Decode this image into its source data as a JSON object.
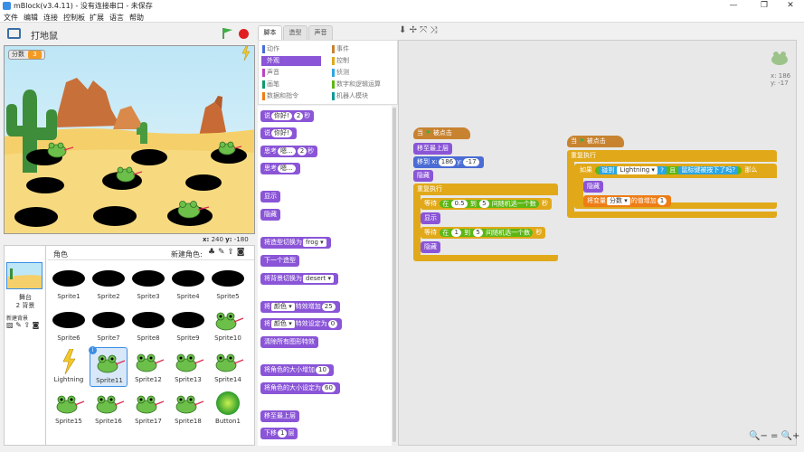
{
  "window": {
    "title": "mBlock(v3.4.11) - 没有连接串口 - 未保存",
    "controls": [
      "—",
      "❐",
      "✕"
    ]
  },
  "menu": [
    "文件",
    "编辑",
    "连接",
    "控制板",
    "扩展",
    "语言",
    "帮助"
  ],
  "stage": {
    "project_name": "打地鼠",
    "score_label": "分数",
    "score_value": "3",
    "mouse_x_label": "x:",
    "mouse_x": "240",
    "mouse_y_label": "y:",
    "mouse_y": "-180"
  },
  "sprites_panel": {
    "header": "角色",
    "new_sprite_label": "新建角色:",
    "stage_label": "舞台",
    "backdrops_count": "2 背景",
    "new_backdrop_label": "新建背景",
    "sprites": [
      {
        "name": "Sprite1",
        "kind": "hole"
      },
      {
        "name": "Sprite2",
        "kind": "hole"
      },
      {
        "name": "Sprite3",
        "kind": "hole"
      },
      {
        "name": "Sprite4",
        "kind": "hole"
      },
      {
        "name": "Sprite5",
        "kind": "hole"
      },
      {
        "name": "Sprite6",
        "kind": "hole"
      },
      {
        "name": "Sprite7",
        "kind": "hole"
      },
      {
        "name": "Sprite8",
        "kind": "hole"
      },
      {
        "name": "Sprite9",
        "kind": "hole"
      },
      {
        "name": "Sprite10",
        "kind": "frog"
      },
      {
        "name": "Lightning",
        "kind": "lightning"
      },
      {
        "name": "Sprite11",
        "kind": "frog",
        "selected": true,
        "badge": "i"
      },
      {
        "name": "Sprite12",
        "kind": "frog"
      },
      {
        "name": "Sprite13",
        "kind": "frog"
      },
      {
        "name": "Sprite14",
        "kind": "frog"
      },
      {
        "name": "Sprite15",
        "kind": "frog"
      },
      {
        "name": "Sprite16",
        "kind": "frog"
      },
      {
        "name": "Sprite17",
        "kind": "frog"
      },
      {
        "name": "Sprite18",
        "kind": "frog"
      },
      {
        "name": "Button1",
        "kind": "button"
      }
    ]
  },
  "tabs": [
    "脚本",
    "造型",
    "声音"
  ],
  "categories": [
    {
      "label": "动作",
      "color": "#4a6cd4"
    },
    {
      "label": "事件",
      "color": "#c88330"
    },
    {
      "label": "外观",
      "color": "#8a55d7",
      "active": true
    },
    {
      "label": "控制",
      "color": "#e1a91a"
    },
    {
      "label": "声音",
      "color": "#bb42c3"
    },
    {
      "label": "侦测",
      "color": "#2ca5e2"
    },
    {
      "label": "画笔",
      "color": "#0e9a6c"
    },
    {
      "label": "数字和逻辑运算",
      "color": "#5cb712"
    },
    {
      "label": "数据和指令",
      "color": "#ee7d16"
    },
    {
      "label": "机器人模块",
      "color": "#0e9a9a"
    }
  ],
  "palette": {
    "say_timed": {
      "pre": "说",
      "text": "你好!",
      "secs": "2",
      "post": "秒"
    },
    "say": {
      "pre": "说",
      "text": "你好!"
    },
    "think_timed": {
      "pre": "思考",
      "text": "嗯...",
      "secs": "2",
      "post": "秒"
    },
    "think": {
      "pre": "思考",
      "text": "嗯..."
    },
    "show": "显示",
    "hide": "隐藏",
    "switch_costume": {
      "pre": "将造型切换为",
      "value": "frog"
    },
    "next_costume": "下一个造型",
    "switch_backdrop": {
      "pre": "将背景切换为",
      "value": "desert"
    },
    "change_effect": {
      "pre": "将",
      "effect": "颜色",
      "mid": "特效增加",
      "value": "25"
    },
    "set_effect": {
      "pre": "将",
      "effect": "颜色",
      "mid": "特效设定为",
      "value": "0"
    },
    "clear_effects": "清除所有图形特效",
    "change_size": {
      "pre": "将角色的大小增加",
      "value": "10"
    },
    "set_size": {
      "pre": "将角色的大小设定为",
      "value": "60"
    },
    "go_front": "移至最上层",
    "go_back": {
      "pre": "下移",
      "value": "1",
      "post": "层"
    }
  },
  "scripts": {
    "s1": {
      "hat_pre": "当",
      "hat_post": "被点击",
      "front": "移至最上层",
      "goto_pre": "移到 x:",
      "goto_x": "186",
      "goto_mid": "y:",
      "goto_y": "-17",
      "hide": "隐藏",
      "forever": "重复执行",
      "wait1_pre": "等待",
      "wait1_mid": "在",
      "wait1_a": "0.5",
      "wait1_to": "到",
      "wait1_b": "5",
      "wait1_rand": "间随机选一个数",
      "wait1_post": "秒",
      "show": "显示",
      "wait2_pre": "等待",
      "wait2_mid": "在",
      "wait2_a": "1",
      "wait2_to": "到",
      "wait2_b": "5",
      "wait2_rand": "间随机选一个数",
      "wait2_post": "秒",
      "hide2": "隐藏"
    },
    "s2": {
      "hat_pre": "当",
      "hat_post": "被点击",
      "forever": "重复执行",
      "if": "如果",
      "touch_pre": "碰到",
      "touch_value": "Lightning",
      "q": "?",
      "and": "且",
      "mouse": "鼠标键被按下了吗?",
      "then": "那么",
      "hide": "隐藏",
      "change_pre": "将变量",
      "change_var": "分数",
      "change_mid": "的值增加",
      "change_val": "1"
    }
  },
  "script_coords": {
    "x_label": "x:",
    "x": "186",
    "y_label": "y:",
    "y": "-17"
  },
  "zoom": [
    "🔍−",
    "=",
    "🔍+"
  ]
}
